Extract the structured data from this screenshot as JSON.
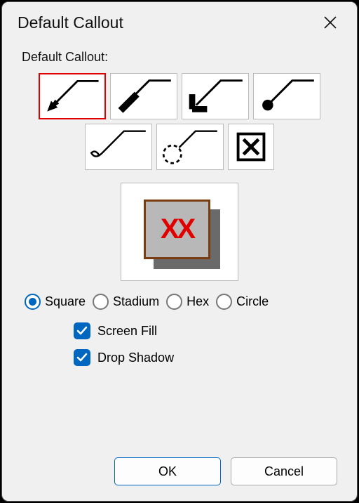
{
  "window": {
    "title": "Default Callout"
  },
  "group": {
    "label": "Default Callout:"
  },
  "preview": {
    "text": "XX"
  },
  "shapes": {
    "selected": "square",
    "options": {
      "square": "Square",
      "stadium": "Stadium",
      "hex": "Hex",
      "circle": "Circle"
    }
  },
  "checks": {
    "screen_fill": {
      "label": "Screen Fill",
      "checked": true
    },
    "drop_shadow": {
      "label": "Drop Shadow",
      "checked": true
    }
  },
  "buttons": {
    "ok": "OK",
    "cancel": "Cancel"
  },
  "callout_styles": [
    {
      "id": "arrow-filled",
      "selected": true
    },
    {
      "id": "line-thick"
    },
    {
      "id": "arrow-wide"
    },
    {
      "id": "dot-end"
    },
    {
      "id": "hook-end"
    },
    {
      "id": "circle-dashed"
    },
    {
      "id": "x-box"
    }
  ]
}
